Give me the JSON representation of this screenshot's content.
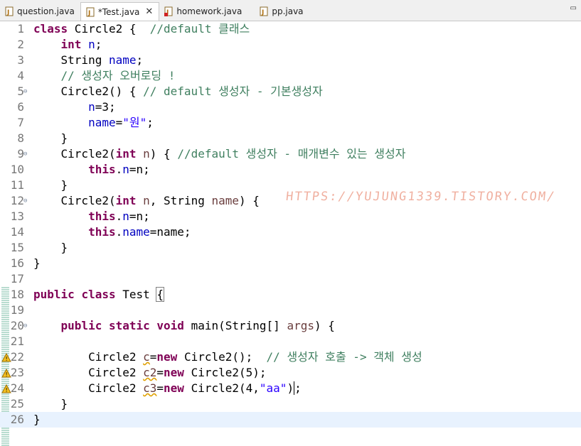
{
  "tabs": [
    {
      "label": "question.java",
      "active": false
    },
    {
      "label": "*Test.java",
      "active": true
    },
    {
      "label": "homework.java",
      "active": false
    },
    {
      "label": "pp.java",
      "active": false
    }
  ],
  "tab_close_glyph": "✕",
  "restore_glyph": "▭",
  "watermark": "HTTPS://YUJUNG1339.TISTORY.COM/",
  "lines": [
    {
      "n": "1",
      "fold": false,
      "tokens": [
        {
          "t": "class",
          "c": "kw"
        },
        {
          "t": " Circle2 {  "
        },
        {
          "t": "//default 클래스",
          "c": "cm"
        }
      ]
    },
    {
      "n": "2",
      "fold": false,
      "tokens": [
        {
          "t": "    "
        },
        {
          "t": "int",
          "c": "kw"
        },
        {
          "t": " "
        },
        {
          "t": "n",
          "c": "fld"
        },
        {
          "t": ";"
        }
      ]
    },
    {
      "n": "3",
      "fold": false,
      "tokens": [
        {
          "t": "    String "
        },
        {
          "t": "name",
          "c": "fld"
        },
        {
          "t": ";"
        }
      ]
    },
    {
      "n": "4",
      "fold": false,
      "tokens": [
        {
          "t": "    "
        },
        {
          "t": "// 생성자 오버로딩 !",
          "c": "cm"
        }
      ]
    },
    {
      "n": "5",
      "fold": true,
      "tokens": [
        {
          "t": "    Circle2() { "
        },
        {
          "t": "// default 생성자 - 기본생성자",
          "c": "cm"
        }
      ]
    },
    {
      "n": "6",
      "fold": false,
      "tokens": [
        {
          "t": "        "
        },
        {
          "t": "n",
          "c": "fld"
        },
        {
          "t": "=3;"
        }
      ]
    },
    {
      "n": "7",
      "fold": false,
      "tokens": [
        {
          "t": "        "
        },
        {
          "t": "name",
          "c": "fld"
        },
        {
          "t": "="
        },
        {
          "t": "\"원\"",
          "c": "str"
        },
        {
          "t": ";"
        }
      ]
    },
    {
      "n": "8",
      "fold": false,
      "tokens": [
        {
          "t": "    }"
        }
      ]
    },
    {
      "n": "9",
      "fold": true,
      "tokens": [
        {
          "t": "    Circle2("
        },
        {
          "t": "int",
          "c": "kw"
        },
        {
          "t": " "
        },
        {
          "t": "n",
          "c": "var"
        },
        {
          "t": ") { "
        },
        {
          "t": "//default 생성자 - 매개변수 있는 생성자",
          "c": "cm"
        }
      ]
    },
    {
      "n": "10",
      "fold": false,
      "tokens": [
        {
          "t": "        "
        },
        {
          "t": "this",
          "c": "kw"
        },
        {
          "t": "."
        },
        {
          "t": "n",
          "c": "fld"
        },
        {
          "t": "=n;"
        }
      ]
    },
    {
      "n": "11",
      "fold": false,
      "tokens": [
        {
          "t": "    }"
        }
      ]
    },
    {
      "n": "12",
      "fold": true,
      "tokens": [
        {
          "t": "    Circle2("
        },
        {
          "t": "int",
          "c": "kw"
        },
        {
          "t": " "
        },
        {
          "t": "n",
          "c": "var"
        },
        {
          "t": ", String "
        },
        {
          "t": "name",
          "c": "var"
        },
        {
          "t": ") {"
        }
      ]
    },
    {
      "n": "13",
      "fold": false,
      "tokens": [
        {
          "t": "        "
        },
        {
          "t": "this",
          "c": "kw"
        },
        {
          "t": "."
        },
        {
          "t": "n",
          "c": "fld"
        },
        {
          "t": "=n;"
        }
      ]
    },
    {
      "n": "14",
      "fold": false,
      "tokens": [
        {
          "t": "        "
        },
        {
          "t": "this",
          "c": "kw"
        },
        {
          "t": "."
        },
        {
          "t": "name",
          "c": "fld"
        },
        {
          "t": "=name;"
        }
      ]
    },
    {
      "n": "15",
      "fold": false,
      "tokens": [
        {
          "t": "    }"
        }
      ]
    },
    {
      "n": "16",
      "fold": false,
      "tokens": [
        {
          "t": "}"
        }
      ]
    },
    {
      "n": "17",
      "fold": false,
      "tokens": []
    },
    {
      "n": "18",
      "fold": false,
      "tokens": [
        {
          "t": "public",
          "c": "kw"
        },
        {
          "t": " "
        },
        {
          "t": "class",
          "c": "kw"
        },
        {
          "t": " Test "
        },
        {
          "t": "{",
          "c": "box"
        }
      ]
    },
    {
      "n": "19",
      "fold": false,
      "tokens": []
    },
    {
      "n": "20",
      "fold": true,
      "tokens": [
        {
          "t": "    "
        },
        {
          "t": "public",
          "c": "kw"
        },
        {
          "t": " "
        },
        {
          "t": "static",
          "c": "kw"
        },
        {
          "t": " "
        },
        {
          "t": "void",
          "c": "kw"
        },
        {
          "t": " main(String[] "
        },
        {
          "t": "args",
          "c": "var"
        },
        {
          "t": ") {"
        }
      ]
    },
    {
      "n": "21",
      "fold": false,
      "tokens": []
    },
    {
      "n": "22",
      "fold": false,
      "warn": true,
      "tokens": [
        {
          "t": "        Circle2 "
        },
        {
          "t": "c",
          "c": "uvar"
        },
        {
          "t": "="
        },
        {
          "t": "new",
          "c": "kw"
        },
        {
          "t": " Circle2();  "
        },
        {
          "t": "// 생성자 호출 -> 객체 생성",
          "c": "cm"
        }
      ]
    },
    {
      "n": "23",
      "fold": false,
      "warn": true,
      "tokens": [
        {
          "t": "        Circle2 "
        },
        {
          "t": "c2",
          "c": "uvar"
        },
        {
          "t": "="
        },
        {
          "t": "new",
          "c": "kw"
        },
        {
          "t": " Circle2(5);"
        }
      ]
    },
    {
      "n": "24",
      "fold": false,
      "warn": true,
      "tokens": [
        {
          "t": "        Circle2 "
        },
        {
          "t": "c3",
          "c": "uvar"
        },
        {
          "t": "="
        },
        {
          "t": "new",
          "c": "kw"
        },
        {
          "t": " Circle2(4,"
        },
        {
          "t": "\"aa\"",
          "c": "str"
        },
        {
          "t": ")",
          "c": "caret"
        },
        {
          "t": ";"
        }
      ]
    },
    {
      "n": "25",
      "fold": false,
      "tokens": [
        {
          "t": "    }"
        }
      ]
    },
    {
      "n": "26",
      "fold": false,
      "current": true,
      "tokens": [
        {
          "t": "}"
        }
      ]
    }
  ]
}
